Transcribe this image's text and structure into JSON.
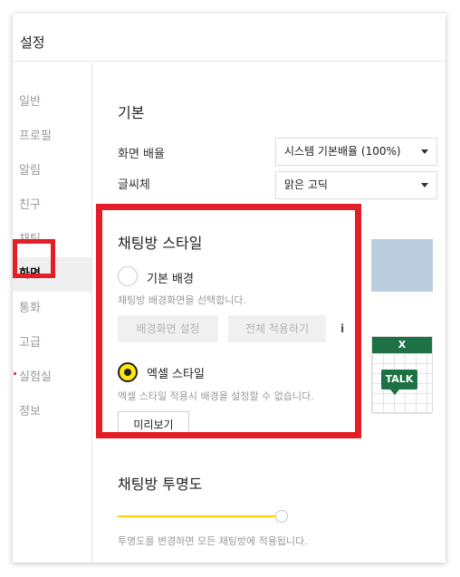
{
  "window": {
    "title": "설정"
  },
  "sidebar": {
    "items": [
      {
        "label": "일반"
      },
      {
        "label": "프로필"
      },
      {
        "label": "알림"
      },
      {
        "label": "친구"
      },
      {
        "label": "채팅"
      },
      {
        "label": "화면",
        "active": true
      },
      {
        "label": "통화"
      },
      {
        "label": "고급"
      },
      {
        "label": "실험실",
        "new_dot": true
      },
      {
        "label": "정보"
      }
    ]
  },
  "basic": {
    "title": "기본",
    "zoom_label": "화면 배율",
    "zoom_value": "시스템 기본배율 (100%)",
    "font_label": "글씨체",
    "font_value": "맑은 고딕"
  },
  "chatroom_style": {
    "title": "채팅방 스타일",
    "basic_bg": {
      "label": "기본 배경",
      "selected": false,
      "desc": "채팅방 배경화면을 선택합니다.",
      "set_bg_button": "배경화면 설정",
      "apply_all_button": "전체 적용하기",
      "info_icon": "i"
    },
    "excel_style": {
      "label": "엑셀 스타일",
      "selected": true,
      "desc": "엑셀 스타일 적용시 배경을 설정할 수 없습니다.",
      "preview_button": "미리보기"
    },
    "excel_preview": {
      "header": "X",
      "badge": "TALK"
    }
  },
  "transparency": {
    "title": "채팅방 투명도",
    "level": 1.0,
    "desc": "투명도를 변경하면 모든 채팅방에 적용됩니다."
  },
  "colors": {
    "accent": "#ffe812",
    "slider": "#ffcd00",
    "highlight": "#e31e26",
    "excel_green": "#1e7145"
  }
}
